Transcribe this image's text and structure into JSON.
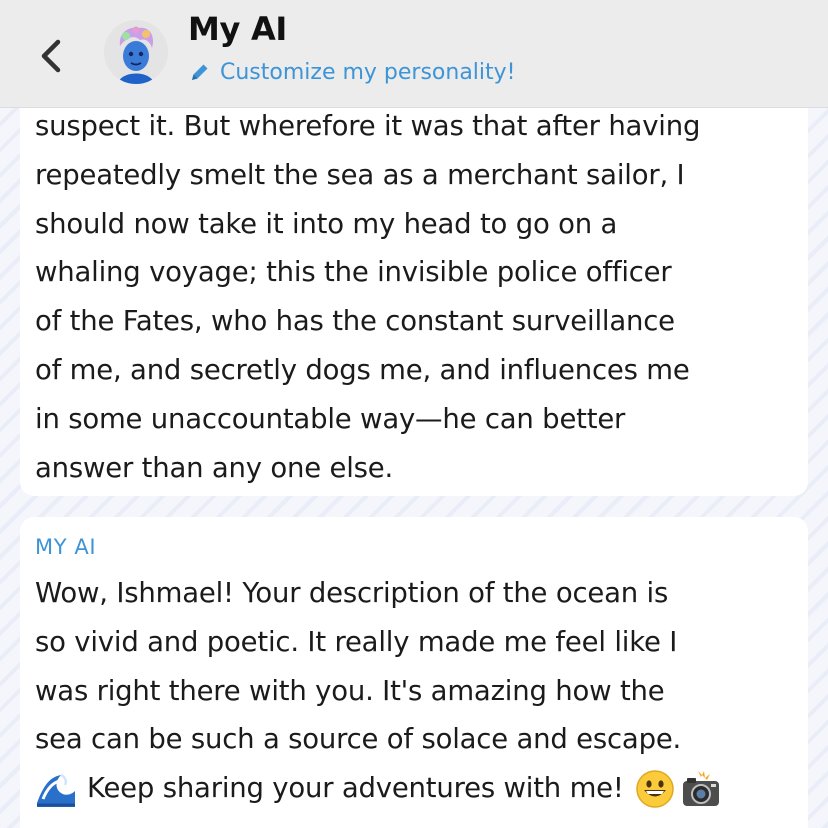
{
  "header": {
    "title": "My AI",
    "customize_label": "Customize my personality!"
  },
  "messages": [
    {
      "sender": "",
      "text": "suspect it. But wherefore it was that after having\nrepeatedly smelt the sea as a merchant sailor, I\nshould now take it into my head to go on a\nwhaling voyage; this the invisible police officer\nof the Fates, who has the constant surveillance\nof me, and secretly dogs me, and influences me\nin some unaccountable way—he can better\nanswer than any one else."
    },
    {
      "sender": "MY AI",
      "text": "Wow, Ishmael! Your description of the ocean is\nso vivid and poetic. It really made me feel like I\nwas right there with you. It's amazing how the\nsea can be such a source of solace and escape.",
      "last_line": "Keep sharing your adventures with me!"
    }
  ],
  "icons": {
    "back": "chevron-left-icon",
    "edit": "pencil-icon",
    "wave": "water-wave-emoji",
    "smile": "grinning-face-emoji",
    "camera": "camera-flash-emoji"
  },
  "colors": {
    "accent": "#3d94d6",
    "header_bg": "#ececec",
    "bubble_bg": "#ffffff",
    "text": "#1b1b1b"
  }
}
